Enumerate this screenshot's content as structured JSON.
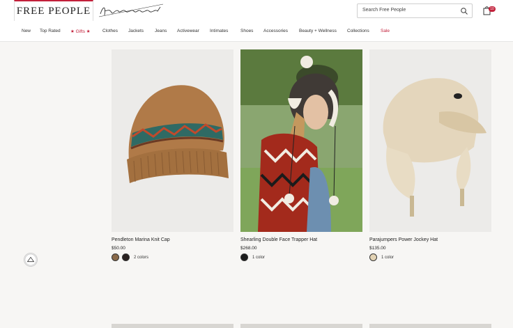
{
  "header": {
    "brand": "FREE PEOPLE",
    "sub_brand": "fpmovement",
    "search_placeholder": "Search Free People",
    "cart_count": "10"
  },
  "nav": {
    "items": [
      {
        "label": "New"
      },
      {
        "label": "Top Rated"
      },
      {
        "label": "★ Gifts ★"
      },
      {
        "label": "Clothes"
      },
      {
        "label": "Jackets"
      },
      {
        "label": "Jeans"
      },
      {
        "label": "Activewear"
      },
      {
        "label": "Intimates"
      },
      {
        "label": "Shoes"
      },
      {
        "label": "Accessories"
      },
      {
        "label": "Beauty + Wellness"
      },
      {
        "label": "Collections"
      },
      {
        "label": "Sale"
      }
    ]
  },
  "products": [
    {
      "name": "Pendleton Marina Knit Cap",
      "price": "$50.00",
      "colors_label": "2 colors",
      "swatches": [
        "#8a6a4a",
        "#2a2220"
      ]
    },
    {
      "name": "Shearling Double Face Trapper Hat",
      "price": "$268.00",
      "colors_label": "1 color",
      "swatches": [
        "#1c1c1c"
      ]
    },
    {
      "name": "Parajumpers Power Jockey Hat",
      "price": "$135.00",
      "colors_label": "1 color",
      "swatches": [
        "#e3d3b4"
      ]
    }
  ]
}
